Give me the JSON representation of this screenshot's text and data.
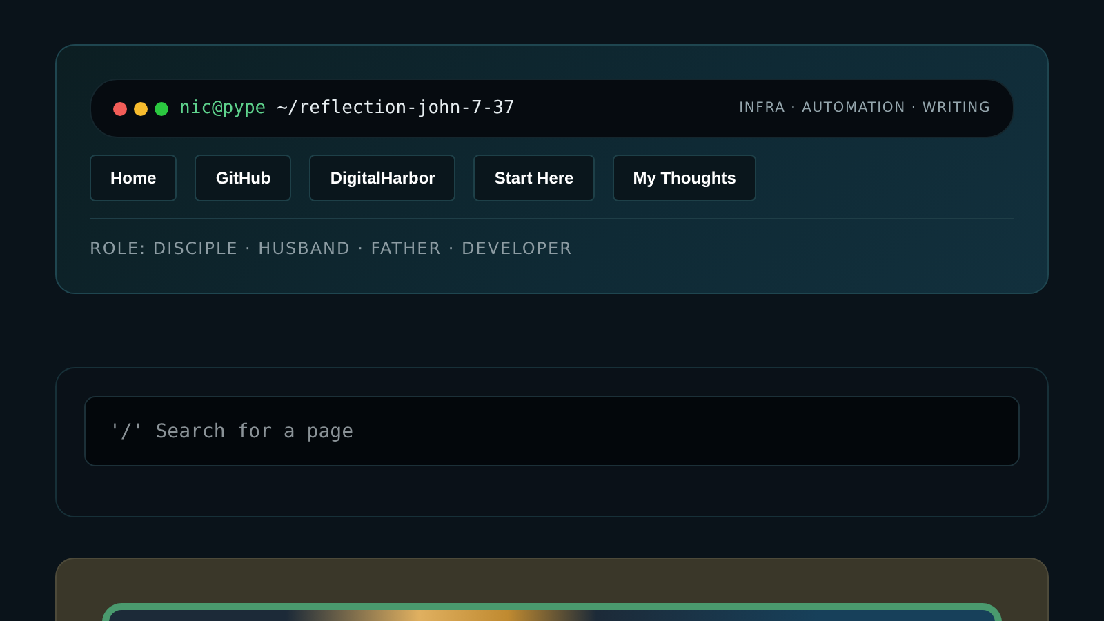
{
  "terminal": {
    "user": "nic@pype",
    "path": "~/reflection-john-7-37",
    "tagline": "INFRA · AUTOMATION · WRITING"
  },
  "nav": [
    "Home",
    "GitHub",
    "DigitalHarbor",
    "Start Here",
    "My Thoughts"
  ],
  "role": "ROLE: DISCIPLE · HUSBAND · FATHER · DEVELOPER",
  "search": {
    "placeholder": "'/' Search for a page"
  }
}
